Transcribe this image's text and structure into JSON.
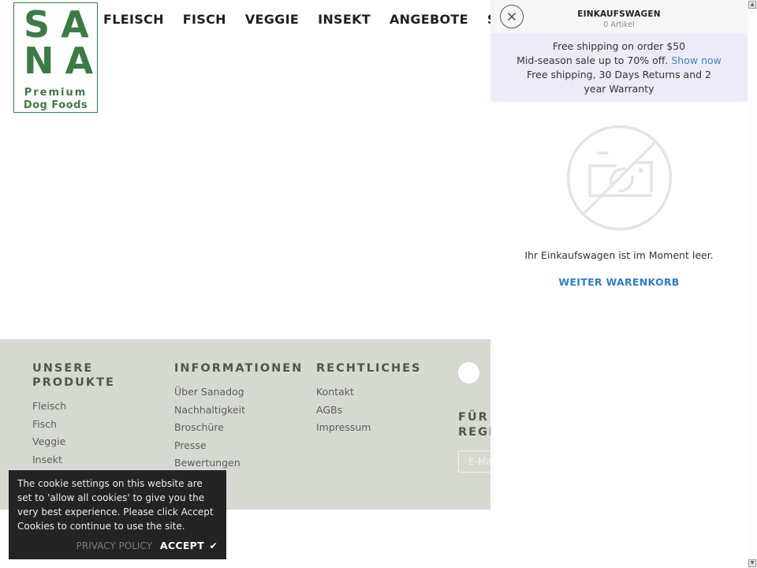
{
  "logo": {
    "line1": "SA",
    "line2": "NA",
    "line3": "Premium",
    "line4": "Dog Foods"
  },
  "nav": {
    "items": [
      "FLEISCH",
      "FISCH",
      "VEGGIE",
      "INSEKT",
      "ANGEBOTE",
      "SCHNÄPPCHEN"
    ]
  },
  "cart": {
    "close_icon": "close-icon",
    "title": "EINKAUFSWAGEN",
    "count": "0 Artikel",
    "promo": {
      "line1": "Free shipping on order $50",
      "line2": "Mid-season sale up to 70% off.",
      "line2_link": "Show now",
      "line3": "Free shipping, 30 Days Returns and 2 year Warranty"
    },
    "empty_icon": "no-image-icon",
    "empty_text": "Ihr Einkaufswagen ist im Moment leer.",
    "continue_label": "WEITER WARENKORB",
    "link_color": "#3b86c4"
  },
  "footer": {
    "columns": [
      {
        "title": "UNSERE PRODUKTE",
        "links": [
          "Fleisch",
          "Fisch",
          "Veggie",
          "Insekt"
        ]
      },
      {
        "title": "INFORMATIONEN",
        "links": [
          "Über Sanadog",
          "Nachhaltigkeit",
          "Broschüre",
          "Presse",
          "Bewertungen"
        ]
      },
      {
        "title": "RECHTLICHES",
        "links": [
          "Kontakt",
          "AGBs",
          "Impressum"
        ]
      }
    ],
    "newsletter": {
      "title_line1": "FÜR",
      "title_line2": "REGI",
      "email_placeholder": "E-Mail"
    },
    "bg_color": "#d6d9d1",
    "heading_color": "#4a5a49"
  },
  "cookie": {
    "text": "The cookie settings on this website are set to 'allow all cookies' to give you the very best experience. Please click Accept Cookies to continue to use the site.",
    "privacy_label": "PRIVACY POLICY",
    "accept_label": "ACCEPT",
    "check_icon": "✔"
  },
  "brand_color": "#3e7a45"
}
